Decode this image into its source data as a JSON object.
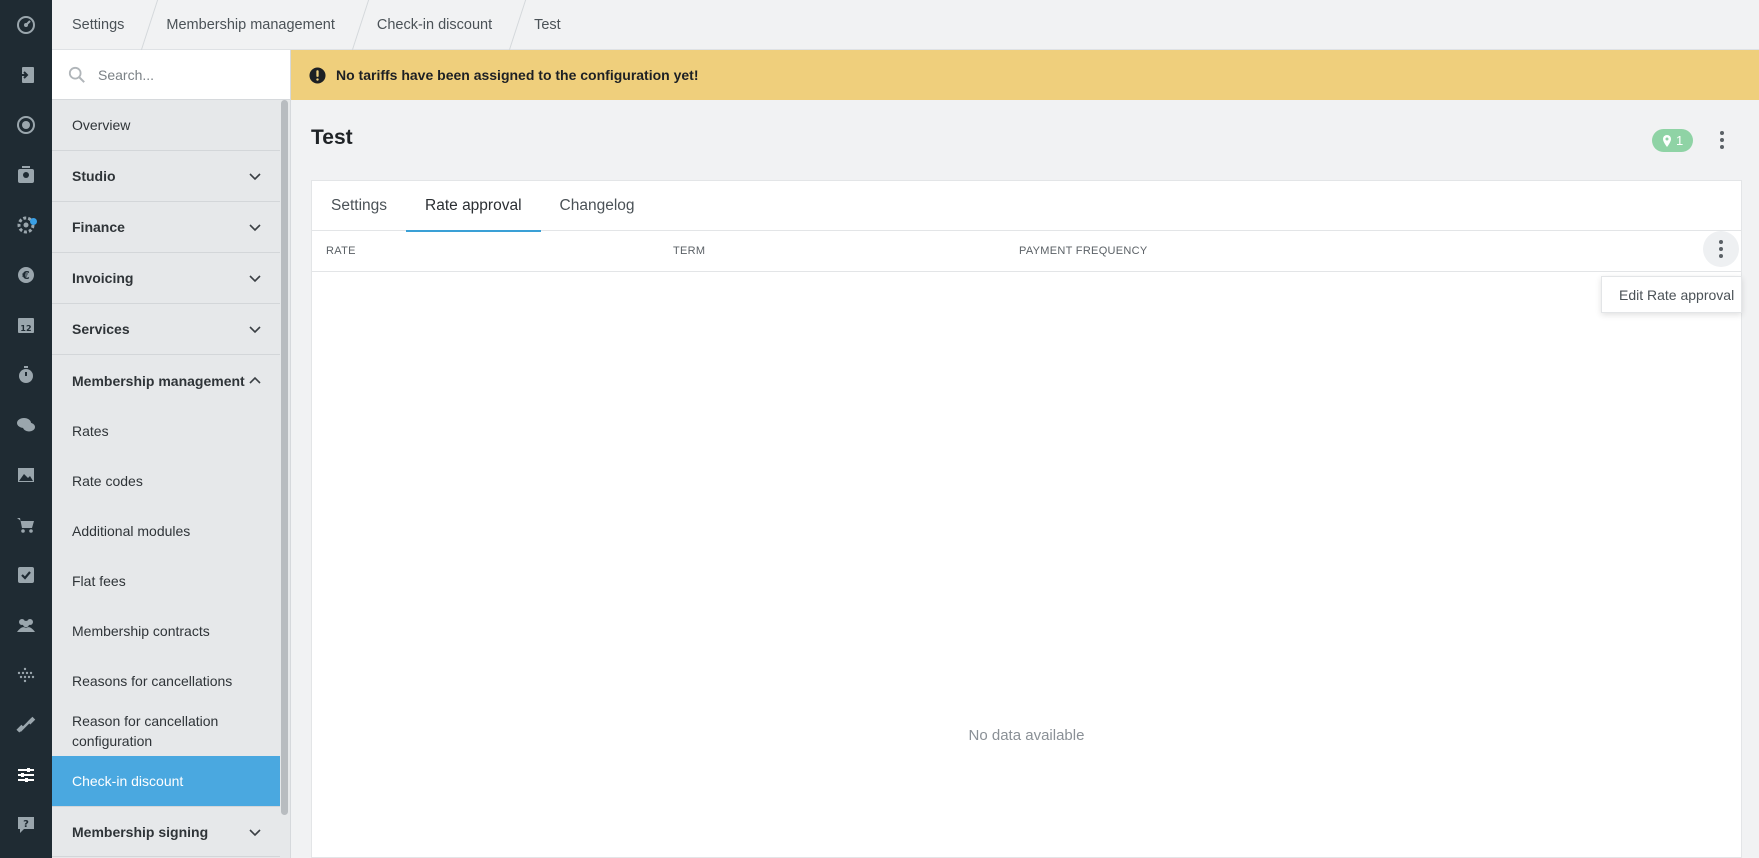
{
  "rail": {
    "icons": [
      "dashboard-icon",
      "check-in-icon",
      "target-icon",
      "contacts-icon",
      "settings-gear-icon",
      "euro-icon",
      "calendar-icon",
      "stopwatch-icon",
      "chat-icon",
      "image-icon",
      "cart-icon",
      "checkbox-icon",
      "people-icon",
      "dots-grid-icon",
      "dumbbell-icon",
      "sliders-icon",
      "help-chat-icon"
    ],
    "calendar_number": "12"
  },
  "breadcrumb": [
    "Settings",
    "Membership management",
    "Check-in discount",
    "Test"
  ],
  "search": {
    "placeholder": "Search..."
  },
  "sidebar": {
    "overview": "Overview",
    "groups": {
      "studio": "Studio",
      "finance": "Finance",
      "invoicing": "Invoicing",
      "services": "Services",
      "membership_management": "Membership management",
      "membership_signing": "Membership signing"
    },
    "sub_items": {
      "rates": "Rates",
      "rate_codes": "Rate codes",
      "additional_modules": "Additional modules",
      "flat_fees": "Flat fees",
      "membership_contracts": "Membership contracts",
      "reasons_for_cancellations": "Reasons for cancellations",
      "reason_for_cancellation_configuration": "Reason for cancellation configuration",
      "check_in_discount": "Check-in discount"
    }
  },
  "banner": {
    "text": "No tariffs have been assigned to the configuration yet!"
  },
  "page": {
    "title": "Test",
    "badge_count": "1"
  },
  "tabs": {
    "settings": "Settings",
    "rate_approval": "Rate approval",
    "changelog": "Changelog"
  },
  "table": {
    "columns": {
      "rate": "RATE",
      "term": "TERM",
      "payment_frequency": "PAYMENT FREQUENCY"
    },
    "empty_text": "No data available"
  },
  "context_menu": {
    "edit": "Edit Rate approval"
  },
  "colors": {
    "accent": "#4aa8e0",
    "banner": "#efcf7c",
    "rail": "#1f2b33",
    "badge": "#8fd3a5"
  }
}
